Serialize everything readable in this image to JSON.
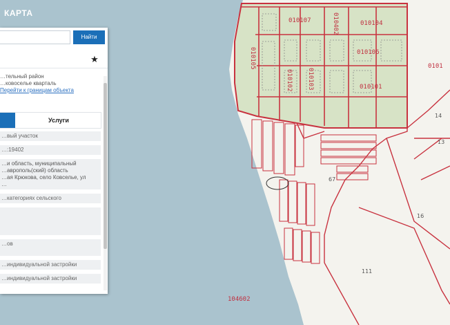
{
  "app": {
    "title": "КАРТА"
  },
  "search": {
    "value": "",
    "button_label": "Найти"
  },
  "toolbar": {
    "favorite_icon": "star-icon",
    "favorite_symbol": "★"
  },
  "info": {
    "lines": [
      "…тельный район",
      "…ковоселье кварталь"
    ],
    "link_text": "Перейти к границам объекта"
  },
  "tabs": [
    {
      "label": ""
    },
    {
      "label": "Услуги"
    }
  ],
  "fields": [
    {
      "label": "…вый участок",
      "value_lines": []
    },
    {
      "label": "…:19402",
      "value_lines": []
    },
    {
      "label": "",
      "value_lines": [
        "…и область, муниципальный",
        "…аврополь(ский) область",
        "…ая Крюкова, село Ковселье, ул",
        "…"
      ]
    },
    {
      "label": "…категориях сельского",
      "value_lines": []
    },
    {
      "label": "",
      "value_lines": []
    },
    {
      "label": "…ов",
      "value_lines": []
    },
    {
      "label": "…индивидуальной застройки",
      "value_lines": []
    },
    {
      "label": "…индивидуальной застройки",
      "value_lines": []
    }
  ],
  "map": {
    "colors": {
      "water": "#aac3ce",
      "land": "#f4f3ee",
      "built_up": "#d7e3c6",
      "boundary": "#c8323f"
    },
    "labels": [
      {
        "id": "q-010107",
        "text": "010107"
      },
      {
        "id": "q-010402",
        "text": "010402"
      },
      {
        "id": "q-010104",
        "text": "010104"
      },
      {
        "id": "q-010105",
        "text": "010105"
      },
      {
        "id": "q-010106",
        "text": "010106"
      },
      {
        "id": "q-010103",
        "text": "010103"
      },
      {
        "id": "q-010101",
        "text": "010101"
      },
      {
        "id": "q-010102",
        "text": "010102"
      },
      {
        "id": "q-0101",
        "text": "0101"
      },
      {
        "id": "q-104602",
        "text": "104602"
      },
      {
        "id": "p-67",
        "text": "67"
      },
      {
        "id": "p-13",
        "text": "13"
      },
      {
        "id": "p-14",
        "text": "14"
      },
      {
        "id": "p-111",
        "text": "111"
      },
      {
        "id": "p-16",
        "text": "16"
      }
    ]
  }
}
